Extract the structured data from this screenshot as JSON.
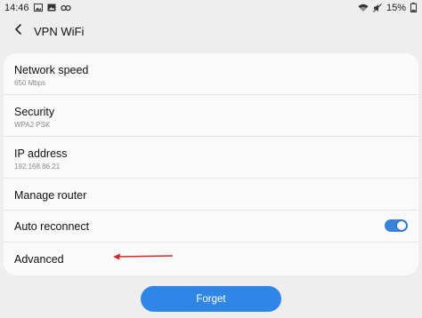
{
  "status_bar": {
    "time": "14:46",
    "battery": "15%",
    "icons": [
      "image-icon",
      "photo-icon",
      "link-icon",
      "wifi-icon",
      "mute-icon",
      "battery-icon"
    ]
  },
  "header": {
    "title": "VPN WiFi",
    "back_icon": "chevron-left-icon"
  },
  "details": {
    "network_speed": {
      "label": "Network speed",
      "value": "650 Mbps"
    },
    "security": {
      "label": "Security",
      "value": "WPA2 PSK"
    },
    "ip_address": {
      "label": "IP address",
      "value": "192.168.86.21"
    },
    "manage_router": {
      "label": "Manage router"
    },
    "auto_reconnect": {
      "label": "Auto reconnect",
      "enabled": true
    },
    "advanced": {
      "label": "Advanced"
    }
  },
  "forget_button": {
    "label": "Forget"
  },
  "colors": {
    "accent": "#2f86e6",
    "toggle_on": "#3a82d9",
    "annotation_arrow": "#d42a2a",
    "background": "#eeeeee",
    "card": "#fafafa"
  }
}
